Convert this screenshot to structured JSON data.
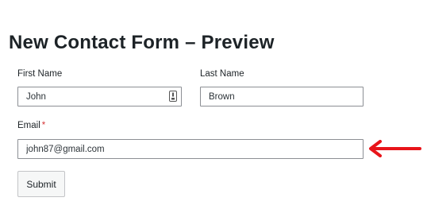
{
  "form": {
    "title": "New Contact Form – Preview",
    "first_name": {
      "label": "First Name",
      "value": "John"
    },
    "last_name": {
      "label": "Last Name",
      "value": "Brown"
    },
    "email": {
      "label": "Email",
      "required_marker": "*",
      "value": "john87@gmail.com"
    },
    "submit_label": "Submit"
  },
  "annotation": {
    "arrow_color": "#e8141a",
    "arrow_icon": "left-arrow-icon"
  },
  "colors": {
    "required": "#d63638",
    "border": "#8c8f94"
  }
}
